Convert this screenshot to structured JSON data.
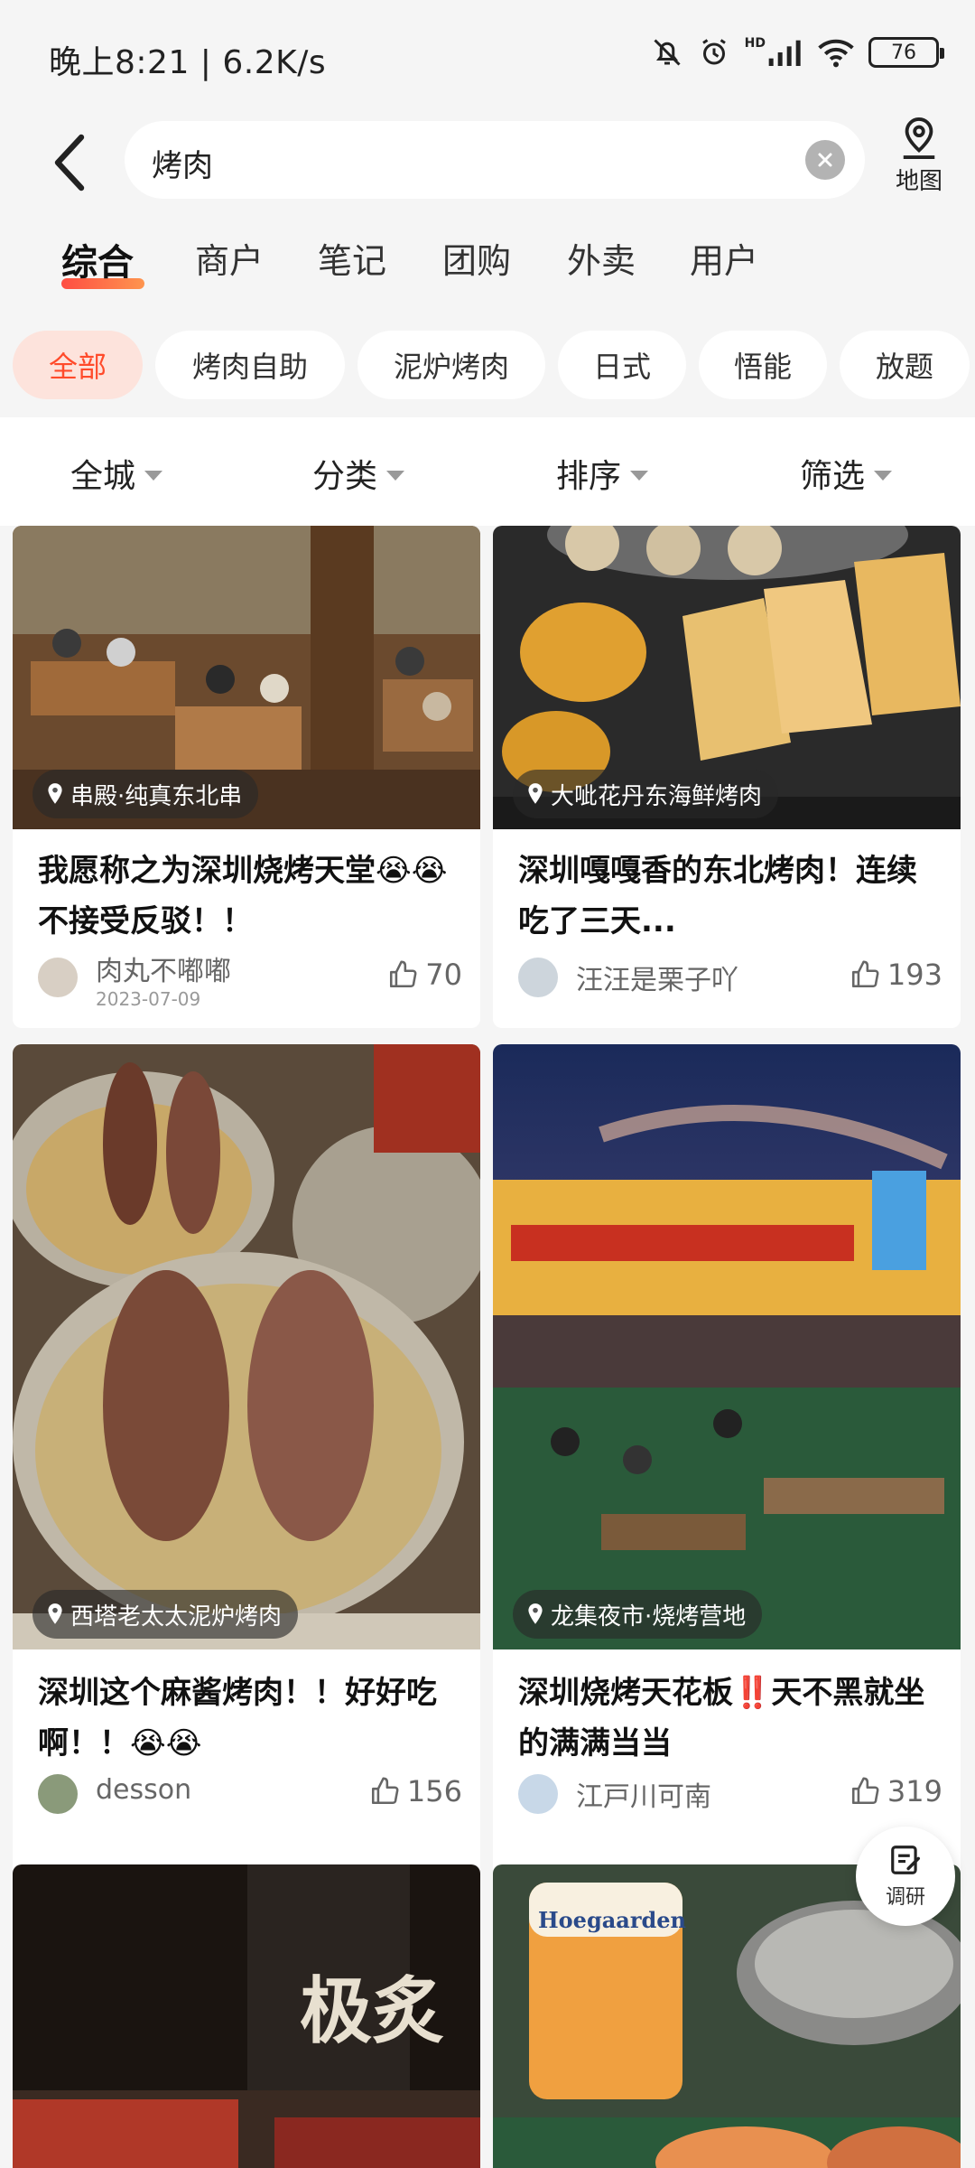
{
  "status_bar": {
    "time_speed": "晚上8:21 | 6.2K/s",
    "battery": "76",
    "network_label": "HD"
  },
  "search": {
    "query": "烤肉",
    "map_label": "地图"
  },
  "tabs": [
    {
      "label": "综合",
      "active": true
    },
    {
      "label": "商户"
    },
    {
      "label": "笔记"
    },
    {
      "label": "团购"
    },
    {
      "label": "外卖"
    },
    {
      "label": "用户"
    }
  ],
  "chips": [
    {
      "label": "全部",
      "active": true
    },
    {
      "label": "烤肉自助"
    },
    {
      "label": "泥炉烤肉"
    },
    {
      "label": "日式"
    },
    {
      "label": "悟能"
    },
    {
      "label": "放题"
    }
  ],
  "filters": [
    {
      "label": "全城"
    },
    {
      "label": "分类"
    },
    {
      "label": "排序"
    },
    {
      "label": "筛选"
    }
  ],
  "cards": [
    {
      "location": "串殿·纯真东北串",
      "title": "我愿称之为深圳烧烤天堂😭😭不接受反驳！！",
      "user": "肉丸不嘟嘟",
      "date": "2023-07-09",
      "likes": "70"
    },
    {
      "location": "大呲花丹东海鲜烤肉",
      "title": "深圳嘎嘎香的东北烤肉！连续吃了三天...",
      "user": "汪汪是栗子吖",
      "likes": "193"
    },
    {
      "location": "西塔老太太泥炉烤肉",
      "title": "深圳这个麻酱烤肉！！好好吃啊！！😭😭",
      "user": "desson",
      "likes": "156"
    },
    {
      "location": "龙集夜市·烧烤营地",
      "title": "深圳烧烤天花板‼️天不黑就坐的满满当当",
      "user": "江戸川可南",
      "likes": "319"
    },
    {
      "sign_text": "极炙"
    },
    {
      "sign_text": "Hoegaarden"
    }
  ],
  "fab": {
    "label": "调研"
  },
  "colors": {
    "accent": "#ff4b2b",
    "chip_active_bg": "#fde3dc",
    "background": "#f5f5f5"
  }
}
